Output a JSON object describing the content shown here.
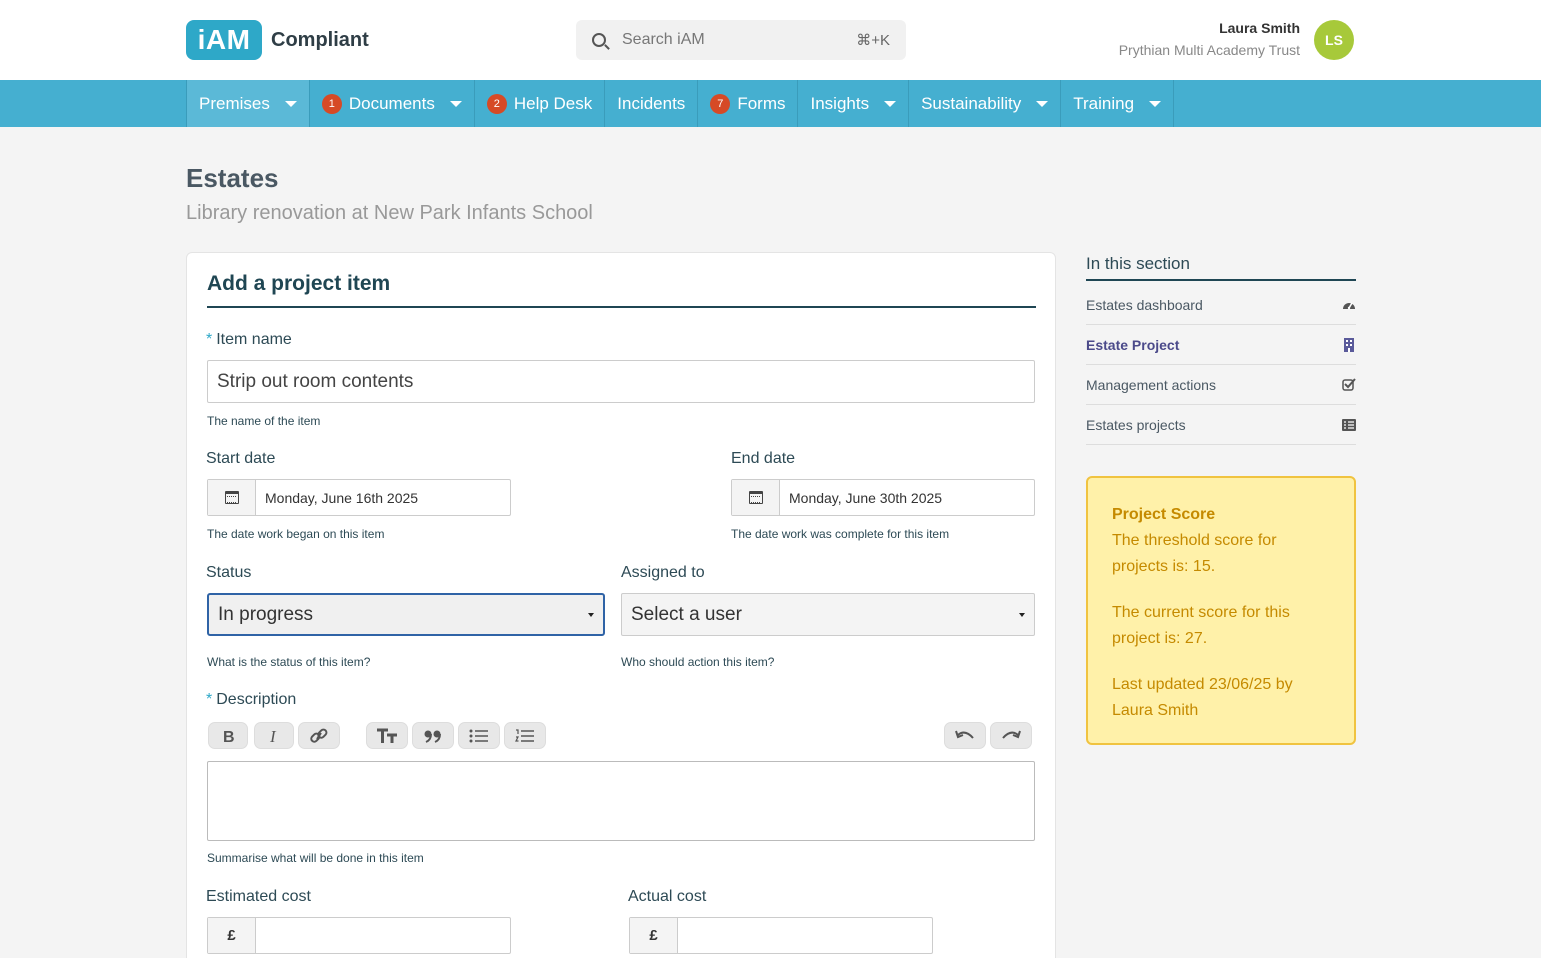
{
  "brand": {
    "logo": "iAM",
    "name": "Compliant",
    "accent": "#2ea8c8"
  },
  "search": {
    "placeholder": "Search iAM",
    "shortcut": "⌘+K"
  },
  "user": {
    "name": "Laura Smith",
    "org": "Prythian Multi Academy Trust",
    "initials": "LS"
  },
  "nav": {
    "items": [
      {
        "label": "Premises",
        "badge": "",
        "dropdown": true
      },
      {
        "label": "Documents",
        "badge": "1",
        "dropdown": true
      },
      {
        "label": "Help Desk",
        "badge": "2",
        "dropdown": false
      },
      {
        "label": "Incidents",
        "badge": "",
        "dropdown": false
      },
      {
        "label": "Forms",
        "badge": "7",
        "dropdown": false
      },
      {
        "label": "Insights",
        "badge": "",
        "dropdown": true
      },
      {
        "label": "Sustainability",
        "badge": "",
        "dropdown": true
      },
      {
        "label": "Training",
        "badge": "",
        "dropdown": true
      }
    ]
  },
  "page": {
    "title": "Estates",
    "subtitle": "Library renovation at New Park Infants School"
  },
  "form": {
    "title": "Add a project item",
    "item_name": {
      "label": "Item name",
      "required_mark": "*",
      "value": "Strip out room contents",
      "hint": "The name of the item"
    },
    "start_date": {
      "label": "Start date",
      "value": "Monday, June 16th 2025",
      "hint": "The date work began on this item"
    },
    "end_date": {
      "label": "End date",
      "value": "Monday, June 30th 2025",
      "hint": "The date work was complete for this item"
    },
    "status": {
      "label": "Status",
      "value": "In progress",
      "hint": "What is the status of this item?"
    },
    "assigned": {
      "label": "Assigned to",
      "value": "Select a user",
      "hint": "Who should action this item?"
    },
    "description": {
      "label": "Description",
      "required_mark": "*",
      "value": "",
      "hint": "Summarise what will be done in this item"
    },
    "estimated_cost": {
      "label": "Estimated cost",
      "currency": "£",
      "value": ""
    },
    "actual_cost": {
      "label": "Actual cost",
      "currency": "£",
      "value": ""
    }
  },
  "sidebar": {
    "title": "In this section",
    "items": [
      {
        "label": "Estates dashboard",
        "icon": "dashboard-icon"
      },
      {
        "label": "Estate Project",
        "icon": "building-icon",
        "current": true
      },
      {
        "label": "Management actions",
        "icon": "checkbox-icon"
      },
      {
        "label": "Estates projects",
        "icon": "list-icon"
      }
    ]
  },
  "score": {
    "title": "Project Score",
    "threshold": "The threshold score for projects is: 15.",
    "current": "The current score for this project is: 27.",
    "updated": "Last updated 23/06/25 by Laura Smith"
  }
}
